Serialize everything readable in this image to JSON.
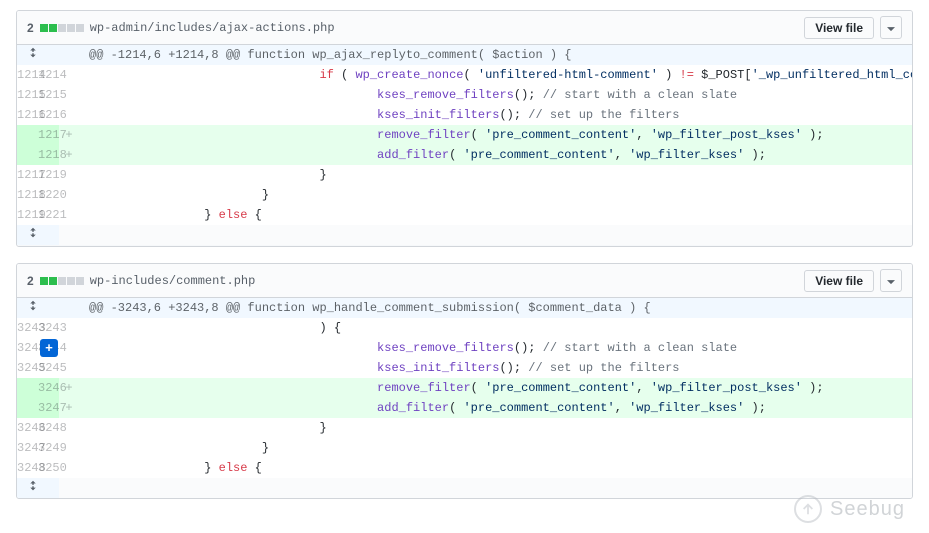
{
  "common": {
    "view_file_label": "View file",
    "chevron_icon_name": "chevron-down-icon",
    "expand_icon_name": "expand-icon",
    "plus_label": "+",
    "watermark_text": "Seebug"
  },
  "files": [
    {
      "change_count": "2",
      "diffstat": {
        "added": 2,
        "neutral": 3
      },
      "path": "wp-admin/includes/ajax-actions.php",
      "hunk_header": "@@ -1214,6 +1214,8 @@ function wp_ajax_replyto_comment( $action ) {",
      "rows": [
        {
          "old": "1214",
          "new": "1214",
          "type": "context",
          "marker": " ",
          "code_segments": [
            {
              "t": "\t\t\t\t"
            },
            {
              "t": "if",
              "c": "k"
            },
            {
              "t": " ( "
            },
            {
              "t": "wp_create_nonce",
              "c": "fn"
            },
            {
              "t": "( "
            },
            {
              "t": "'unfiltered-html-comment'",
              "c": "s"
            },
            {
              "t": " ) "
            },
            {
              "t": "!=",
              "c": "op"
            },
            {
              "t": " "
            },
            {
              "t": "$_POST",
              "c": "v"
            },
            {
              "t": "["
            },
            {
              "t": "'_wp_unfiltered_html_comment'",
              "c": "s"
            },
            {
              "t": "] )"
            }
          ]
        },
        {
          "old": "1215",
          "new": "1215",
          "type": "context",
          "marker": " ",
          "code_segments": [
            {
              "t": "\t\t\t\t\t"
            },
            {
              "t": "kses_remove_filters",
              "c": "fn"
            },
            {
              "t": "(); "
            },
            {
              "t": "// start with a clean slate",
              "c": "c"
            }
          ]
        },
        {
          "old": "1216",
          "new": "1216",
          "type": "context",
          "marker": " ",
          "code_segments": [
            {
              "t": "\t\t\t\t\t"
            },
            {
              "t": "kses_init_filters",
              "c": "fn"
            },
            {
              "t": "(); "
            },
            {
              "t": "// set up the filters",
              "c": "c"
            }
          ]
        },
        {
          "old": "",
          "new": "1217",
          "type": "addition",
          "marker": "+",
          "code_segments": [
            {
              "t": "\t\t\t\t\t"
            },
            {
              "t": "remove_filter",
              "c": "fn"
            },
            {
              "t": "( "
            },
            {
              "t": "'pre_comment_content'",
              "c": "s"
            },
            {
              "t": ", "
            },
            {
              "t": "'wp_filter_post_kses'",
              "c": "s"
            },
            {
              "t": " );"
            }
          ]
        },
        {
          "old": "",
          "new": "1218",
          "type": "addition",
          "marker": "+",
          "code_segments": [
            {
              "t": "\t\t\t\t\t"
            },
            {
              "t": "add_filter",
              "c": "fn"
            },
            {
              "t": "( "
            },
            {
              "t": "'pre_comment_content'",
              "c": "s"
            },
            {
              "t": ", "
            },
            {
              "t": "'wp_filter_kses'",
              "c": "s"
            },
            {
              "t": " );"
            }
          ]
        },
        {
          "old": "1217",
          "new": "1219",
          "type": "context",
          "marker": " ",
          "code_segments": [
            {
              "t": "\t\t\t\t}"
            }
          ]
        },
        {
          "old": "1218",
          "new": "1220",
          "type": "context",
          "marker": " ",
          "code_segments": [
            {
              "t": "\t\t\t}"
            }
          ]
        },
        {
          "old": "1219",
          "new": "1221",
          "type": "context",
          "marker": " ",
          "code_segments": [
            {
              "t": "\t\t} "
            },
            {
              "t": "else",
              "c": "k"
            },
            {
              "t": " {"
            }
          ]
        }
      ],
      "has_hscroll": true,
      "show_plus_at_new": null
    },
    {
      "change_count": "2",
      "diffstat": {
        "added": 2,
        "neutral": 3
      },
      "path": "wp-includes/comment.php",
      "hunk_header": "@@ -3243,6 +3243,8 @@ function wp_handle_comment_submission( $comment_data ) {",
      "rows": [
        {
          "old": "3243",
          "new": "3243",
          "type": "context",
          "marker": " ",
          "code_segments": [
            {
              "t": "\t\t\t\t"
            },
            {
              "t": ") {"
            }
          ]
        },
        {
          "old": "3244",
          "new": "3244",
          "type": "context",
          "marker": " ",
          "code_segments": [
            {
              "t": "\t\t\t\t\t"
            },
            {
              "t": "kses_remove_filters",
              "c": "fn"
            },
            {
              "t": "(); "
            },
            {
              "t": "// start with a clean slate",
              "c": "c"
            }
          ]
        },
        {
          "old": "3245",
          "new": "3245",
          "type": "context",
          "marker": " ",
          "code_segments": [
            {
              "t": "\t\t\t\t\t"
            },
            {
              "t": "kses_init_filters",
              "c": "fn"
            },
            {
              "t": "(); "
            },
            {
              "t": "// set up the filters",
              "c": "c"
            }
          ]
        },
        {
          "old": "",
          "new": "3246",
          "type": "addition",
          "marker": "+",
          "code_segments": [
            {
              "t": "\t\t\t\t\t"
            },
            {
              "t": "remove_filter",
              "c": "fn"
            },
            {
              "t": "( "
            },
            {
              "t": "'pre_comment_content'",
              "c": "s"
            },
            {
              "t": ", "
            },
            {
              "t": "'wp_filter_post_kses'",
              "c": "s"
            },
            {
              "t": " );"
            }
          ]
        },
        {
          "old": "",
          "new": "3247",
          "type": "addition",
          "marker": "+",
          "code_segments": [
            {
              "t": "\t\t\t\t\t"
            },
            {
              "t": "add_filter",
              "c": "fn"
            },
            {
              "t": "( "
            },
            {
              "t": "'pre_comment_content'",
              "c": "s"
            },
            {
              "t": ", "
            },
            {
              "t": "'wp_filter_kses'",
              "c": "s"
            },
            {
              "t": " );"
            }
          ]
        },
        {
          "old": "3246",
          "new": "3248",
          "type": "context",
          "marker": " ",
          "code_segments": [
            {
              "t": "\t\t\t\t}"
            }
          ]
        },
        {
          "old": "3247",
          "new": "3249",
          "type": "context",
          "marker": " ",
          "code_segments": [
            {
              "t": "\t\t\t}"
            }
          ]
        },
        {
          "old": "3248",
          "new": "3250",
          "type": "context",
          "marker": " ",
          "code_segments": [
            {
              "t": "\t\t} "
            },
            {
              "t": "else",
              "c": "k"
            },
            {
              "t": " {"
            }
          ]
        }
      ],
      "has_hscroll": false,
      "show_plus_at_new": "3244"
    }
  ]
}
